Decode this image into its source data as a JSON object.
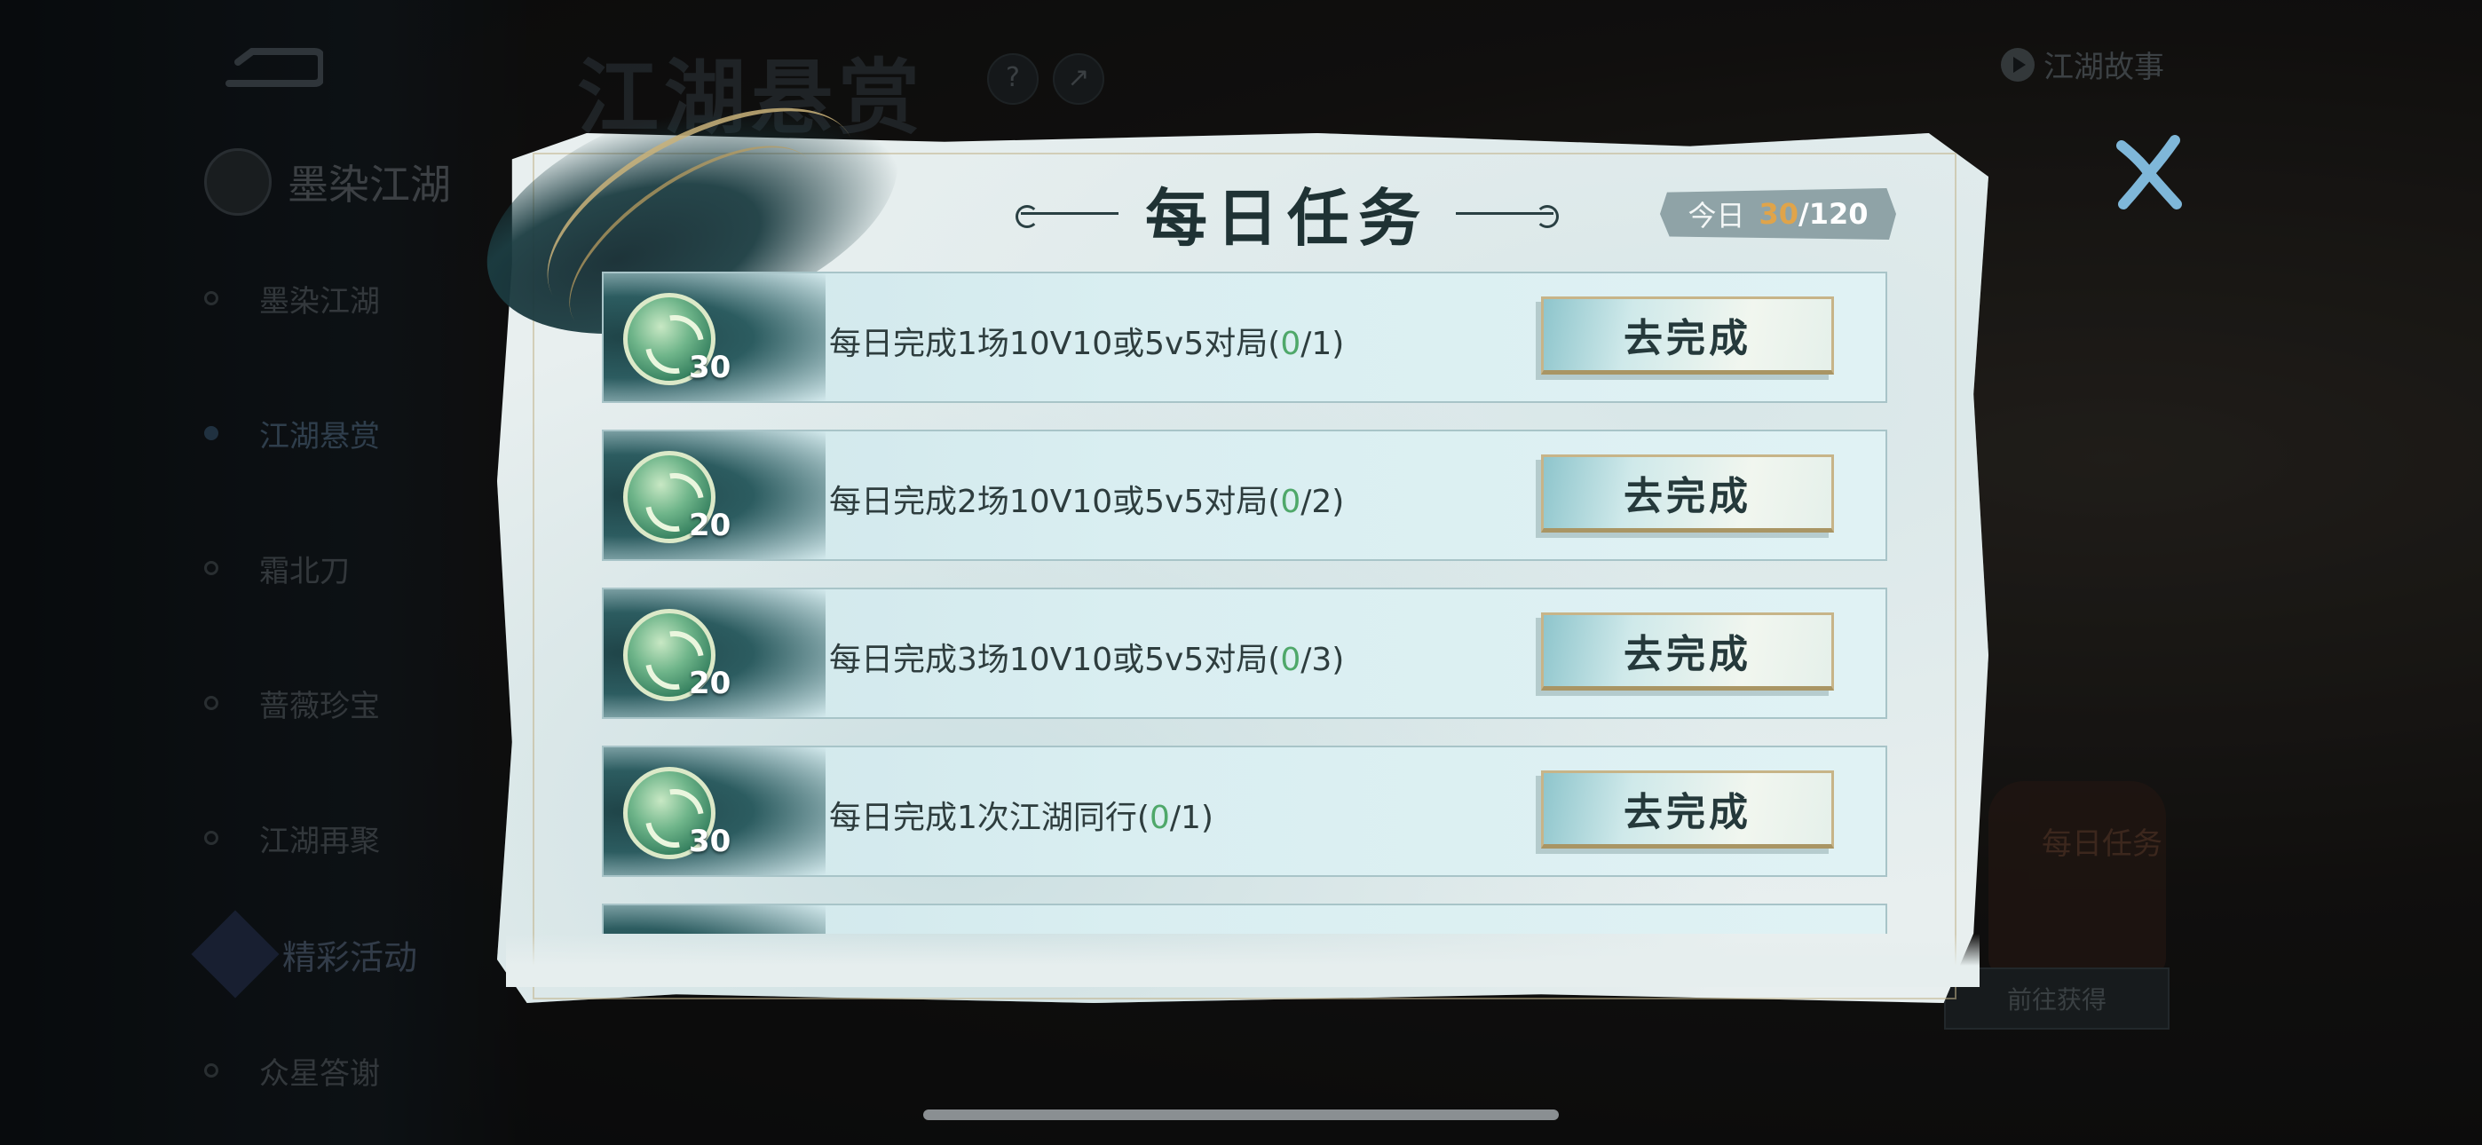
{
  "background": {
    "title": "江湖悬赏",
    "story_link": "江湖故事",
    "help_icon": "?",
    "share_icon": "↗",
    "nav_header": "墨染江湖",
    "nav_items": [
      "墨染江湖",
      "江湖悬赏",
      "霜北刀",
      "蔷薇珍宝",
      "江湖再聚"
    ],
    "nav_active_index": 1,
    "nav_section": "精彩活动",
    "nav_section_items": [
      "众星答谢"
    ],
    "deco_text": "每日任务",
    "get_button": "前往获得"
  },
  "modal": {
    "title": "每日任务",
    "today_label": "今日",
    "today_current": "30",
    "today_total": "/120",
    "go_label": "去完成",
    "tasks": [
      {
        "reward": "30",
        "text": "每日完成1场10V10或5v5对局(",
        "done": "0",
        "goal": "/1)"
      },
      {
        "reward": "20",
        "text": "每日完成2场10V10或5v5对局(",
        "done": "0",
        "goal": "/2)"
      },
      {
        "reward": "20",
        "text": "每日完成3场10V10或5v5对局(",
        "done": "0",
        "goal": "/3)"
      },
      {
        "reward": "30",
        "text": "每日完成1次江湖同行(",
        "done": "0",
        "goal": "/1)"
      }
    ]
  },
  "colors": {
    "accent_gold": "#e0a44a",
    "progress_green": "#4fa86a",
    "panel_bg": "#e8efef",
    "row_bg": "#d9eef1",
    "ink_dark": "#1f3234"
  }
}
